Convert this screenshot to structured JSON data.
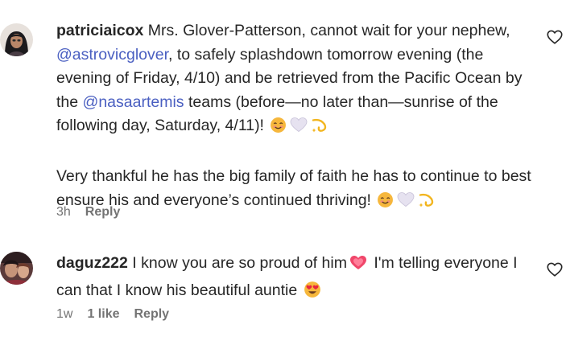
{
  "comments": [
    {
      "username": "patriciaicox",
      "paragraph1": {
        "t1": " Mrs. Glover-Patterson, cannot wait for your nephew, ",
        "mention1": "@astrovicglover",
        "t2": ", to safely splashdown tomorrow evening (the evening of Friday, 4/10) and be retrieved from the Pacific Ocean by the ",
        "mention2": "@nasaartemis",
        "t3": " teams (before—no later than—sunrise of the following day, Saturday, 4/11)! "
      },
      "paragraph2": {
        "t1": "Very thankful he has the big family of faith he has to continue to best ensure his and everyone’s continued thriving! "
      },
      "time": "3h",
      "reply_label": "Reply",
      "emojis": [
        "smiling-face-emoji",
        "white-heart-emoji",
        "dizzy-emoji"
      ]
    },
    {
      "username": "daguz222",
      "text1": " I know you are so proud of him",
      "text2": " I'm telling everyone I can that I know his beautiful auntie ",
      "time": "1w",
      "likes": "1 like",
      "reply_label": "Reply",
      "emojis": [
        "growing-heart-emoji",
        "heart-eyes-emoji"
      ]
    }
  ],
  "colors": {
    "text": "#262626",
    "mention": "#4a5fc1",
    "meta": "#737373"
  }
}
